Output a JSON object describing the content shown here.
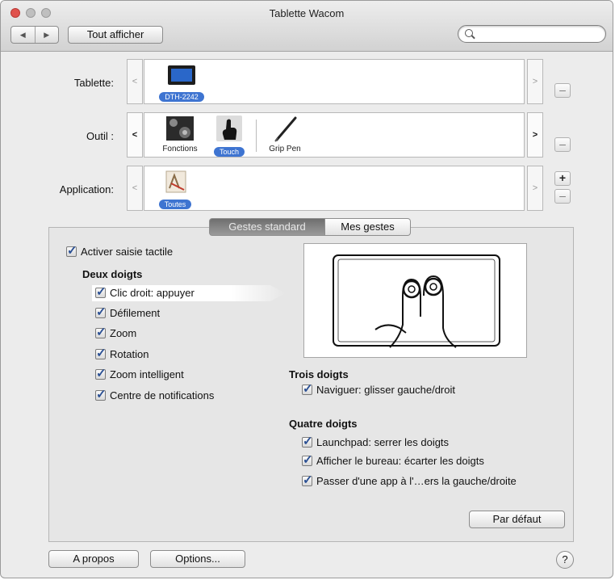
{
  "window": {
    "title": "Tablette Wacom"
  },
  "toolbar": {
    "back_arrow": "◀",
    "forward_arrow": "▶",
    "show_all": "Tout afficher",
    "search_placeholder": ""
  },
  "rows": {
    "tablet": {
      "label": "Tablette:",
      "items": [
        {
          "name": "DTH-2242",
          "selected": true
        }
      ]
    },
    "tool": {
      "label": "Outil :",
      "items": [
        {
          "name": "Fonctions",
          "selected": false
        },
        {
          "name": "Touch",
          "selected": true
        },
        {
          "name": "Grip Pen",
          "selected": false
        }
      ]
    },
    "application": {
      "label": "Application:",
      "items": [
        {
          "name": "Toutes",
          "selected": true
        }
      ]
    }
  },
  "controls": {
    "prev": "<",
    "next": ">",
    "add": "+",
    "remove": "–"
  },
  "tabs": [
    {
      "label": "Gestes standard",
      "active": true
    },
    {
      "label": "Mes gestes",
      "active": false
    }
  ],
  "gestures": {
    "enable_touch": {
      "label": "Activer saisie tactile",
      "checked": true
    },
    "two_fingers": {
      "title": "Deux doigts",
      "items": [
        {
          "label": "Clic droit: appuyer",
          "checked": true,
          "highlighted": true
        },
        {
          "label": "Défilement",
          "checked": true
        },
        {
          "label": "Zoom",
          "checked": true
        },
        {
          "label": "Rotation",
          "checked": true
        },
        {
          "label": "Zoom intelligent",
          "checked": true
        },
        {
          "label": "Centre de notifications",
          "checked": true
        }
      ]
    },
    "three_fingers": {
      "title": "Trois doigts",
      "items": [
        {
          "label": "Naviguer: glisser gauche/droit",
          "checked": true
        }
      ]
    },
    "four_fingers": {
      "title": "Quatre doigts",
      "items": [
        {
          "label": "Launchpad: serrer les doigts",
          "checked": true
        },
        {
          "label": "Afficher le bureau: écarter les doigts",
          "checked": true
        },
        {
          "label": "Passer d'une app à l'…ers la gauche/droite",
          "checked": true
        }
      ]
    }
  },
  "buttons": {
    "default": "Par défaut",
    "about": "A propos",
    "options": "Options...",
    "help": "?"
  },
  "colors": {
    "selection_pill": "#3e74d1",
    "checkmark": "#2a4f93",
    "close_button": "#e0524d"
  },
  "icons": {
    "search": "search-icon",
    "tablet": "tablet-device-icon",
    "functions": "express-keys-icon",
    "touch": "hand-touch-icon",
    "pen": "grip-pen-icon",
    "app": "all-applications-icon",
    "gesture_preview": "two-finger-tap-illustration"
  }
}
